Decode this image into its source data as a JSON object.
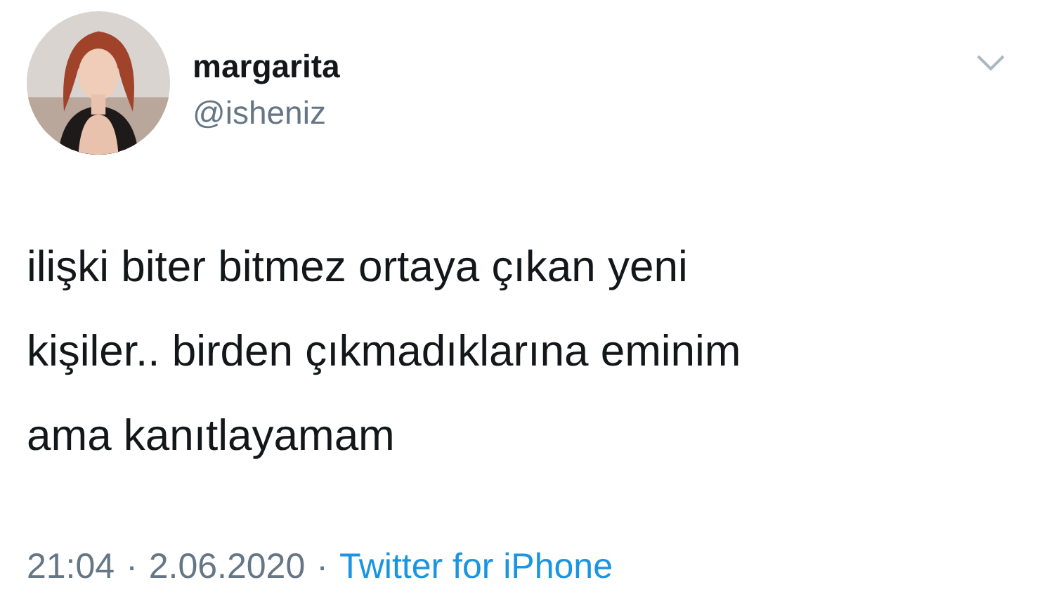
{
  "author": {
    "name": "margarita",
    "handle": "@isheniz"
  },
  "tweet": {
    "lines": [
      "ilişki biter bitmez ortaya çıkan yeni",
      "kişiler.. birden çıkmadıklarına eminim",
      "ama kanıtlayamam"
    ]
  },
  "meta": {
    "time": "21:04",
    "separator": "·",
    "date": "2.06.2020",
    "source": "Twitter for iPhone"
  }
}
